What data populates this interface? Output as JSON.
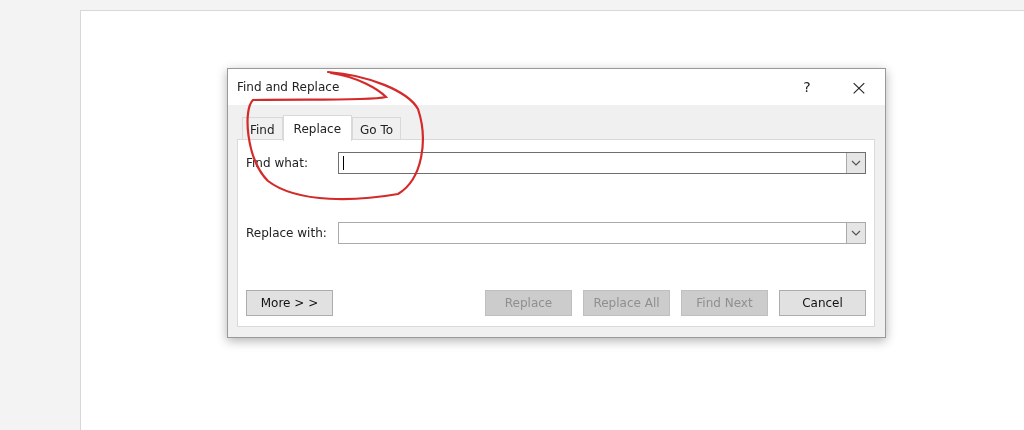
{
  "dialog": {
    "title": "Find and Replace",
    "help": "?",
    "close": "×"
  },
  "tabs": [
    {
      "label": "Find",
      "selected": false
    },
    {
      "label": "Replace",
      "selected": true
    },
    {
      "label": "Go To",
      "selected": false
    }
  ],
  "fields": [
    {
      "label": "Find what:",
      "focused": true
    },
    {
      "label": "Replace with:",
      "focused": false
    }
  ],
  "left_buttons": [
    {
      "label": "More > >",
      "disabled": false
    }
  ],
  "right_buttons": [
    {
      "label": "Replace",
      "disabled": true
    },
    {
      "label": "Replace All",
      "disabled": true
    },
    {
      "label": "Find Next",
      "disabled": true
    },
    {
      "label": "Cancel",
      "disabled": false
    }
  ]
}
